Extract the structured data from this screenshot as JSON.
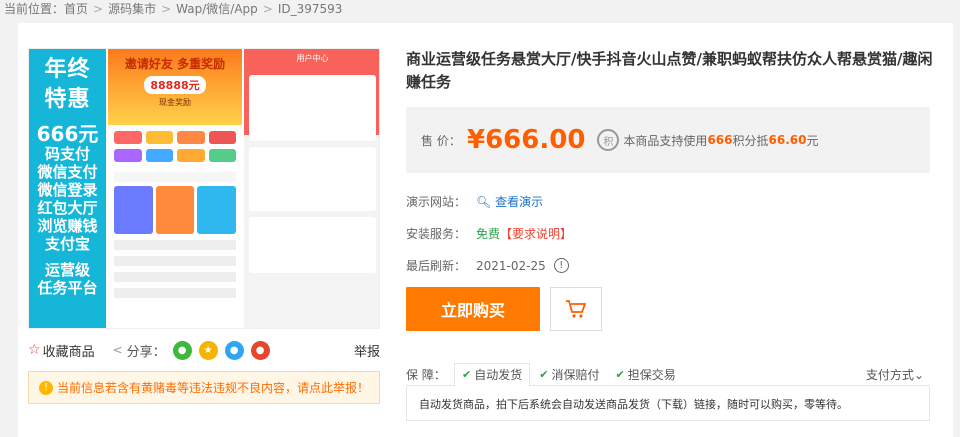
{
  "breadcrumb": {
    "label": "当前位置：",
    "items": [
      "首页",
      "源码集市",
      "Wap/微信/App",
      "ID_397593"
    ],
    "separator": ">"
  },
  "gallery": {
    "promo_lines": [
      "年终",
      "特惠",
      "666元",
      "码支付",
      "微信支付",
      "微信登录",
      "红包大厅",
      "浏览赚钱",
      "支付宝",
      "运营级",
      "任务平台"
    ],
    "shot1_banner_title": "邀请好友 多重奖励",
    "shot1_banner_amount": "88888元",
    "shot1_banner_sub": "现金奖励",
    "shot2_header": "用户中心"
  },
  "actions": {
    "favorite": "收藏商品",
    "share": "分享：",
    "report": "举报"
  },
  "warning": "当前信息若含有黄赌毒等违法违规不良内容，请点此举报！",
  "product": {
    "title": "商业运营级任务悬赏大厅/快手抖音火山点赞/兼职蚂蚁帮扶仿众人帮悬赏猫/趣闲赚任务",
    "price_label": "售 价：",
    "price": "¥666.00",
    "points_icon": "积",
    "points_pre": "本商品支持使用",
    "points_value": "666",
    "points_mid": "积分抵",
    "points_cash": "66.60",
    "points_suffix": "元",
    "demo_label": "演示网站：",
    "demo_link": "查看演示",
    "install_label": "安装服务：",
    "install_value": "免费",
    "install_note": "【要求说明】",
    "refresh_label": "最后刷新：",
    "refresh_date": "2021-02-25",
    "buy_button": "立即购买"
  },
  "guarantee": {
    "label": "保 障：",
    "tabs": [
      "自动发货",
      "消保赔付",
      "担保交易"
    ],
    "pay_label": "支付方式",
    "description": "自动发货商品，拍下后系统会自动发送商品发货（下载）链接，随时可以购买，零等待。"
  },
  "colors": {
    "accent": "#ff7a00",
    "price": "#ff5e00",
    "promo_bg": "#16b6d9",
    "link": "#1a73c9"
  }
}
